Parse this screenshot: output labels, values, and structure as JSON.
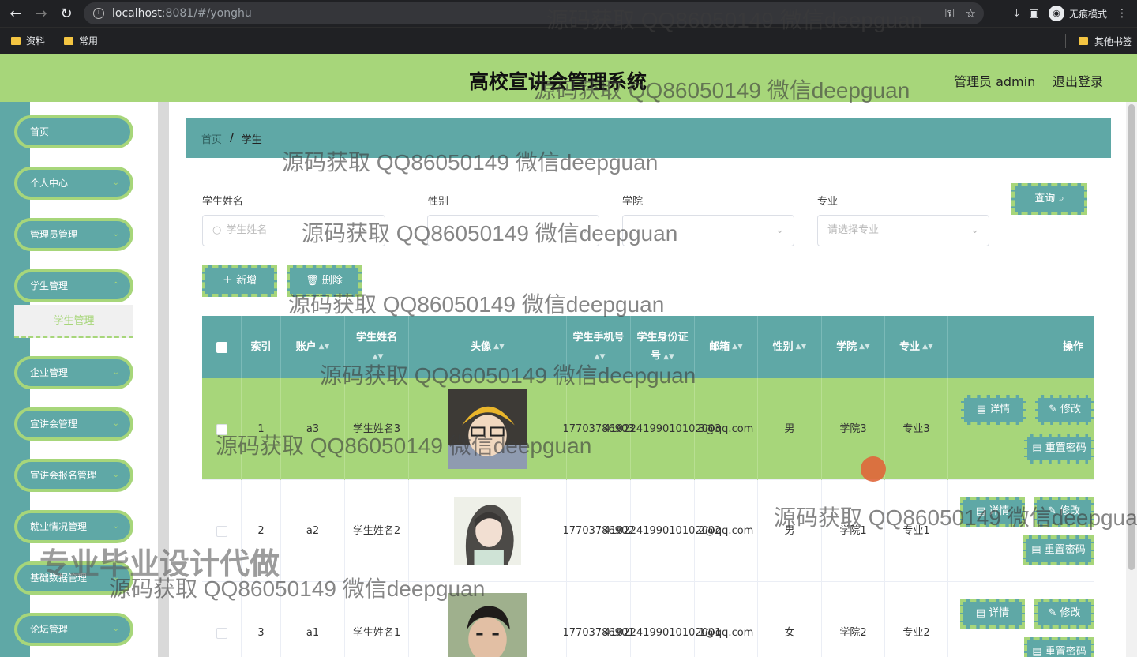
{
  "browser": {
    "url_host": "localhost",
    "url_path": ":8081/#/yonghu",
    "incognito_label": "无痕模式",
    "bookmarks": [
      "资料",
      "常用"
    ],
    "other_bookmarks": "其他书签"
  },
  "header": {
    "title": "高校宣讲会管理系统",
    "user": "管理员 admin",
    "logout": "退出登录"
  },
  "sidebar": {
    "items": [
      "首页",
      "个人中心",
      "管理员管理",
      "学生管理",
      "企业管理",
      "宣讲会管理",
      "宣讲会报名管理",
      "就业情况管理",
      "基础数据管理",
      "论坛管理"
    ],
    "active_sub": "学生管理"
  },
  "breadcrumb": {
    "home": "首页",
    "sep": "/",
    "current": "学生"
  },
  "search": {
    "name_label": "学生姓名",
    "name_placeholder": "学生姓名",
    "gender_label": "性别",
    "college_label": "学院",
    "major_label": "专业",
    "major_placeholder": "请选择专业",
    "query_button": "查询"
  },
  "actions": {
    "add": "新增",
    "delete": "删除"
  },
  "table": {
    "headers": [
      "索引",
      "账户",
      "学生姓名",
      "头像",
      "学生手机号",
      "学生身份证号",
      "邮箱",
      "性别",
      "学院",
      "专业",
      "操作"
    ],
    "rows": [
      {
        "index": "1",
        "account": "a3",
        "name": "学生姓名3",
        "phone": "17703786903",
        "idcard": "410224199010102003",
        "email": "3@qq.com",
        "gender": "男",
        "college": "学院3",
        "major": "专业3"
      },
      {
        "index": "2",
        "account": "a2",
        "name": "学生姓名2",
        "phone": "17703786902",
        "idcard": "410224199010102002",
        "email": "2@qq.com",
        "gender": "男",
        "college": "学院1",
        "major": "专业1"
      },
      {
        "index": "3",
        "account": "a1",
        "name": "学生姓名1",
        "phone": "17703786901",
        "idcard": "410224199010102001",
        "email": "1@qq.com",
        "gender": "女",
        "college": "学院2",
        "major": "专业2"
      }
    ],
    "op_detail": "详情",
    "op_edit": "修改",
    "op_reset": "重置密码"
  },
  "watermarks": {
    "contact": "源码获取 QQ86050149 微信deepguan",
    "ad": "专业毕业设计代做"
  },
  "colors": {
    "primary": "#5fa8a6",
    "accent": "#a7d67a"
  }
}
